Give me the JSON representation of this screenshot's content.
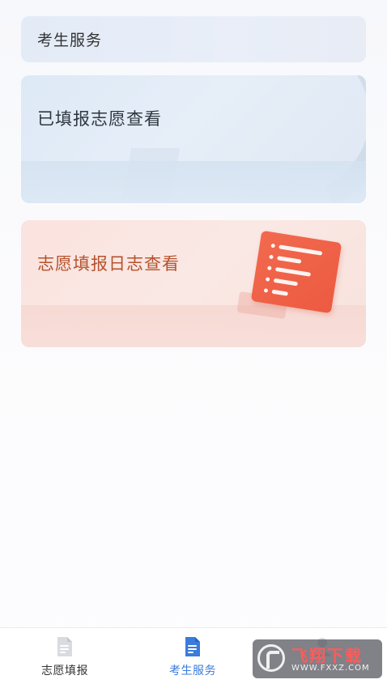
{
  "header": {
    "title": "考生服务"
  },
  "cards": [
    {
      "label": "已填报志愿查看"
    },
    {
      "label": "志愿填报日志查看"
    }
  ],
  "bottom_nav": {
    "items": [
      {
        "label": "志愿填报",
        "icon": "document-icon",
        "active": false
      },
      {
        "label": "考生服务",
        "icon": "document-list-icon",
        "active": true
      },
      {
        "label": "",
        "icon": "user-icon",
        "active": false
      }
    ],
    "active_color": "#3a7bdc"
  },
  "watermark": {
    "title": "飞翔下载",
    "url": "WWW.FXXZ.COM"
  },
  "colors": {
    "card_blue": "#e3ecf7",
    "card_pink": "#fae6e2",
    "pink_text": "#b4532d",
    "doc_illustration": "#f26a4f"
  }
}
